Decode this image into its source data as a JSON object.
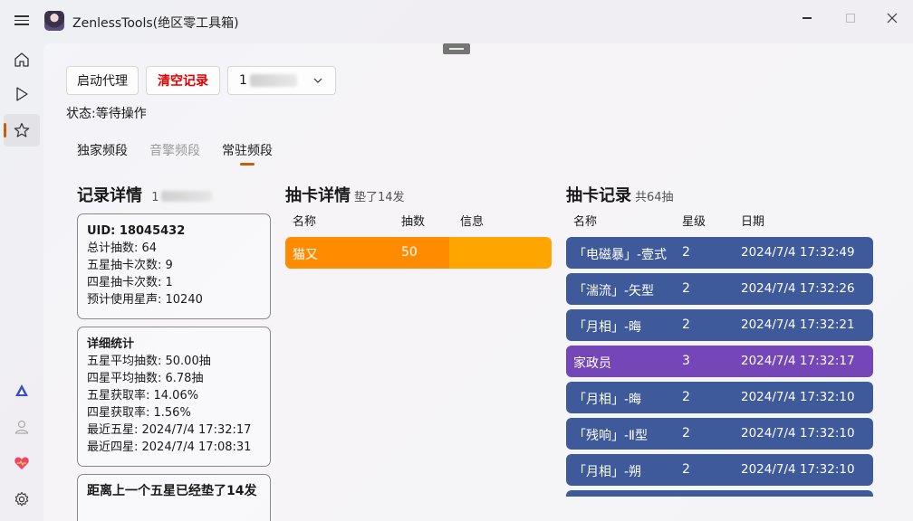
{
  "app": {
    "title": "ZenlessTools(绝区零工具箱)"
  },
  "toolbar": {
    "proxy_label": "启动代理",
    "clear_label": "清空记录",
    "uid_prefix": "1"
  },
  "status": {
    "text": "状态:等待操作"
  },
  "tabs": [
    {
      "label": "独家频段"
    },
    {
      "label": "音擎频段"
    },
    {
      "label": "常驻频段"
    }
  ],
  "records_detail": {
    "title": "记录详情",
    "uid_prefix": "1",
    "uid_line": "UID: 18045432",
    "lines": [
      "总计抽数: 64",
      "五星抽卡次数: 9",
      "四星抽卡次数: 1",
      "预计使用星声: 10240"
    ],
    "stats_title": "详细统计",
    "stats_lines": [
      "五星平均抽数: 50.00抽",
      "四星平均抽数: 6.78抽",
      "五星获取率: 14.06%",
      "四星获取率: 1.56%",
      "最近五星: 2024/7/4 17:32:17",
      "最近四星: 2024/7/4 17:08:31"
    ],
    "since_title": "距离上一个五星已经垫了14发"
  },
  "gacha_detail": {
    "title": "抽卡详情",
    "subtitle": "垫了14发",
    "headers": [
      "名称",
      "抽数",
      "信息"
    ],
    "row": {
      "name": "猫又",
      "count": "50"
    },
    "colors": {
      "primary": "#ff8c00",
      "secondary": "#ffa500"
    }
  },
  "gacha_records": {
    "title": "抽卡记录",
    "subtitle": "共64抽",
    "headers": [
      "名称",
      "星级",
      "日期"
    ],
    "rows": [
      {
        "name": "「电磁暴」-壹式",
        "star": "2",
        "date": "2024/7/4 17:32:49",
        "color": "#3f5a9a"
      },
      {
        "name": "「湍流」-矢型",
        "star": "2",
        "date": "2024/7/4 17:32:26",
        "color": "#3f5a9a"
      },
      {
        "name": "「月相」-晦",
        "star": "2",
        "date": "2024/7/4 17:32:21",
        "color": "#3f5a9a"
      },
      {
        "name": "家政员",
        "star": "3",
        "date": "2024/7/4 17:32:17",
        "color": "#7446b8"
      },
      {
        "name": "「月相」-晦",
        "star": "2",
        "date": "2024/7/4 17:32:10",
        "color": "#3f5a9a"
      },
      {
        "name": "「残响」-Ⅱ型",
        "star": "2",
        "date": "2024/7/4 17:32:10",
        "color": "#3f5a9a"
      },
      {
        "name": "「月相」-朔",
        "star": "2",
        "date": "2024/7/4 17:32:10",
        "color": "#3f5a9a"
      },
      {
        "name": "",
        "star": "",
        "date": "",
        "color": "#3f5a9a"
      }
    ]
  },
  "nav": [
    "home-icon",
    "play-icon",
    "star-icon",
    "triangle-logo-icon",
    "person-icon",
    "heart-icon",
    "gear-icon"
  ]
}
